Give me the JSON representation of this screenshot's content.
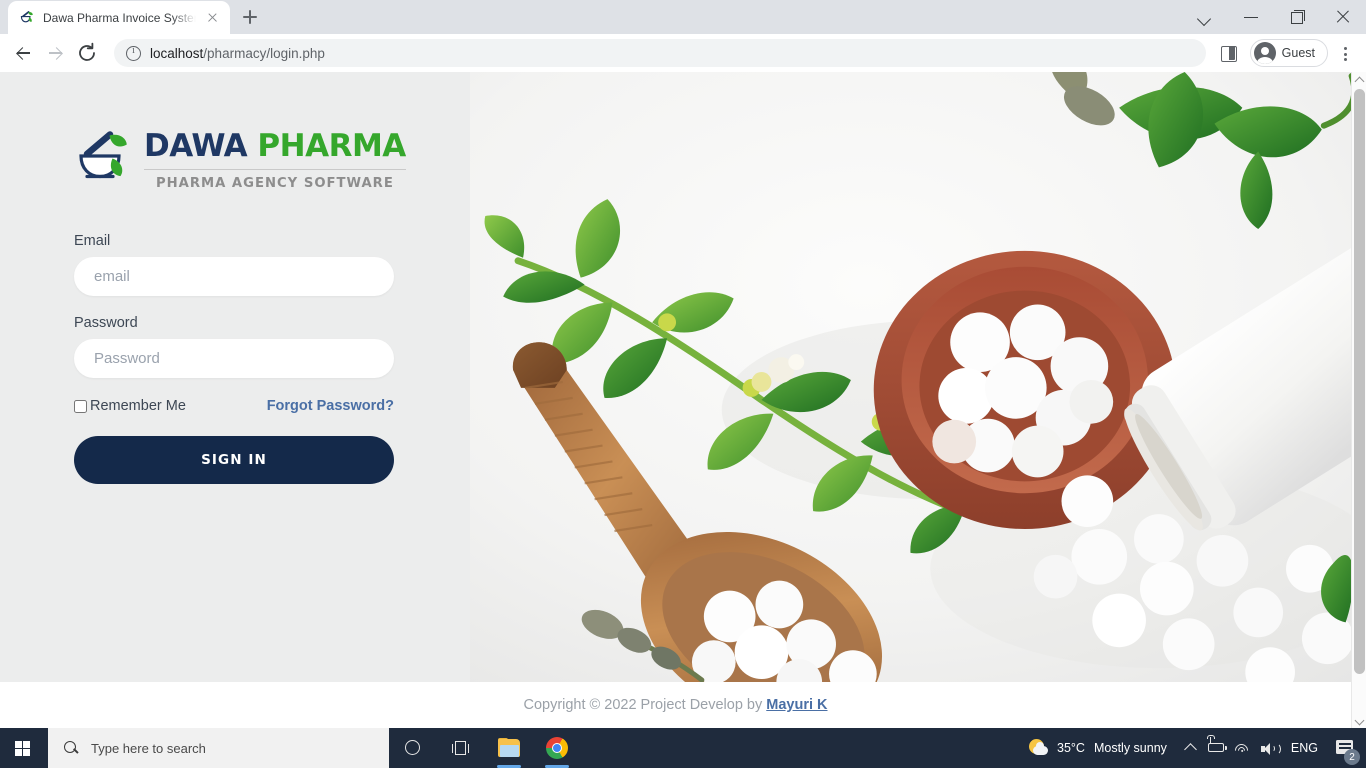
{
  "browser": {
    "tab": {
      "title": "Dawa Pharma Invoice System - M",
      "favicon": "mortar-pestle-icon",
      "close_icon": "close-icon"
    },
    "new_tab_icon": "plus-icon",
    "window_controls": {
      "tab_search": "chevron-down-icon",
      "minimize": "minimize-icon",
      "maximize": "maximize-icon",
      "close": "close-icon"
    },
    "toolbar": {
      "back_icon": "arrow-back-icon",
      "forward_icon": "arrow-forward-icon",
      "reload_icon": "reload-icon",
      "site_info_icon": "info-circle-icon",
      "url_host": "localhost",
      "url_path": "/pharmacy/login.php",
      "side_panel_icon": "side-panel-icon",
      "profile_name": "Guest",
      "menu_icon": "three-dot-menu-icon"
    },
    "scrollbar": {
      "up_icon": "scroll-up-arrow-icon",
      "down_icon": "scroll-down-arrow-icon"
    }
  },
  "page": {
    "logo": {
      "mark": "mortar-pestle-leaf-icon",
      "word_primary": "DAWA",
      "word_secondary": "PHARMA",
      "tagline": "PHARMA AGENCY SOFTWARE",
      "color_primary": "#1f3864",
      "color_secondary": "#35a72c",
      "color_tagline": "#8d8d8d"
    },
    "form": {
      "email_label": "Email",
      "email_value": "",
      "email_placeholder": "email",
      "password_label": "Password",
      "password_value": "",
      "password_placeholder": "Password",
      "remember_label": "Remember Me",
      "remember_checked": false,
      "forgot_label": "Forgot Password?",
      "forgot_color": "#4a6fa5",
      "submit_label": "SIGN IN",
      "submit_color": "#14294a"
    },
    "footer": {
      "text": "Copyright © 2022 Project Develop by",
      "author": "Mayuri K"
    },
    "background_color": "#eceded"
  },
  "taskbar": {
    "start_icon": "windows-start-icon",
    "search_icon": "search-icon",
    "search_placeholder": "Type here to search",
    "cortana_icon": "cortana-icon",
    "task_view_icon": "task-view-icon",
    "file_explorer_icon": "file-explorer-icon",
    "chrome_icon": "chrome-icon",
    "weather_icon": "partly-sunny-icon",
    "temperature": "35°C",
    "condition": "Mostly sunny",
    "tray_expand_icon": "chevron-up-icon",
    "battery_icon": "battery-charging-icon",
    "wifi_icon": "wifi-icon",
    "volume_icon": "volume-icon",
    "language": "ENG",
    "notifications_icon": "notifications-icon",
    "notifications_count": "2"
  }
}
